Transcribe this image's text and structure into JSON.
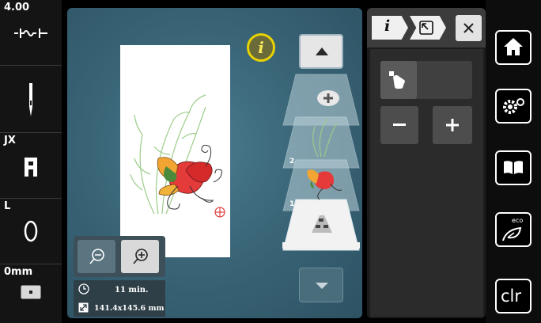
{
  "left_rail": {
    "presser_foot": "4.00",
    "foot_code": "JX",
    "plate_label": "L",
    "zero_label": "0mm"
  },
  "info_badge": "i",
  "tabs": {
    "info_label": "i"
  },
  "stitch_info": {
    "time": "11 min.",
    "size": "141.4x145.6 mm"
  },
  "right_rail": {
    "clr_label": "clr",
    "eco_label": "eco"
  },
  "colors": {
    "canvas": "#3a6678",
    "accent_yellow": "#e8d200"
  },
  "icons": [
    "foot-pressure-icon",
    "needle-icon",
    "presser-foot-icon",
    "needle-plate-icon",
    "feed-dog-icon",
    "info-icon",
    "arrow-up-icon",
    "add-icon",
    "arrow-down-icon",
    "zoom-out-icon",
    "zoom-in-icon",
    "clock-icon",
    "resize-icon",
    "close-icon",
    "hand-icon",
    "minus-icon",
    "plus-icon",
    "home-icon",
    "settings-icon",
    "book-icon",
    "eco-icon"
  ]
}
